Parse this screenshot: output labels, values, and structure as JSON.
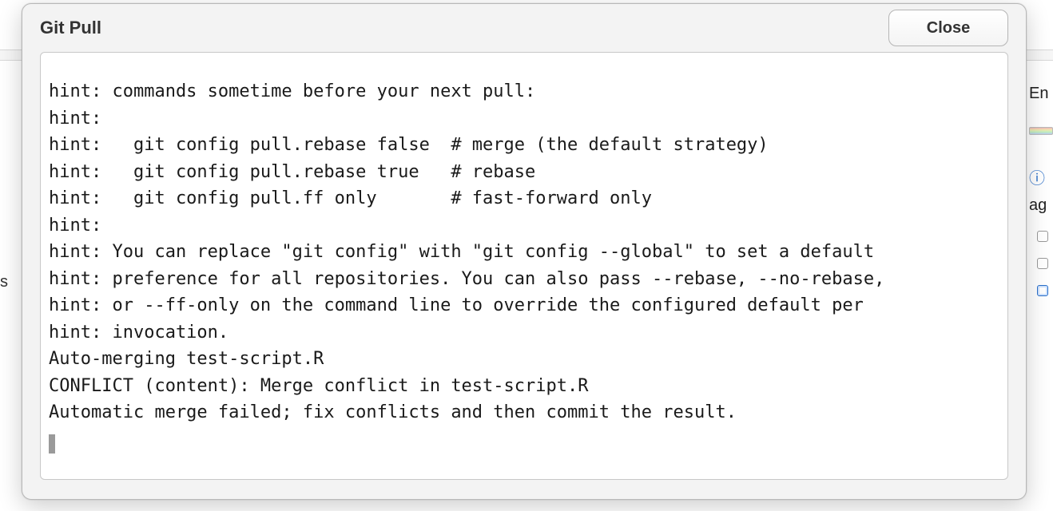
{
  "background": {
    "left_char": "s",
    "right_fragment_top": "En",
    "right_fragment_mid": "ag"
  },
  "dialog": {
    "title": "Git Pull",
    "close_label": "Close",
    "output_lines": [
      "hint: commands sometime before your next pull:",
      "hint:",
      "hint:   git config pull.rebase false  # merge (the default strategy)",
      "hint:   git config pull.rebase true   # rebase",
      "hint:   git config pull.ff only       # fast-forward only",
      "hint:",
      "hint: You can replace \"git config\" with \"git config --global\" to set a default",
      "hint: preference for all repositories. You can also pass --rebase, --no-rebase,",
      "hint: or --ff-only on the command line to override the configured default per",
      "hint: invocation.",
      "Auto-merging test-script.R",
      "CONFLICT (content): Merge conflict in test-script.R",
      "Automatic merge failed; fix conflicts and then commit the result."
    ]
  }
}
